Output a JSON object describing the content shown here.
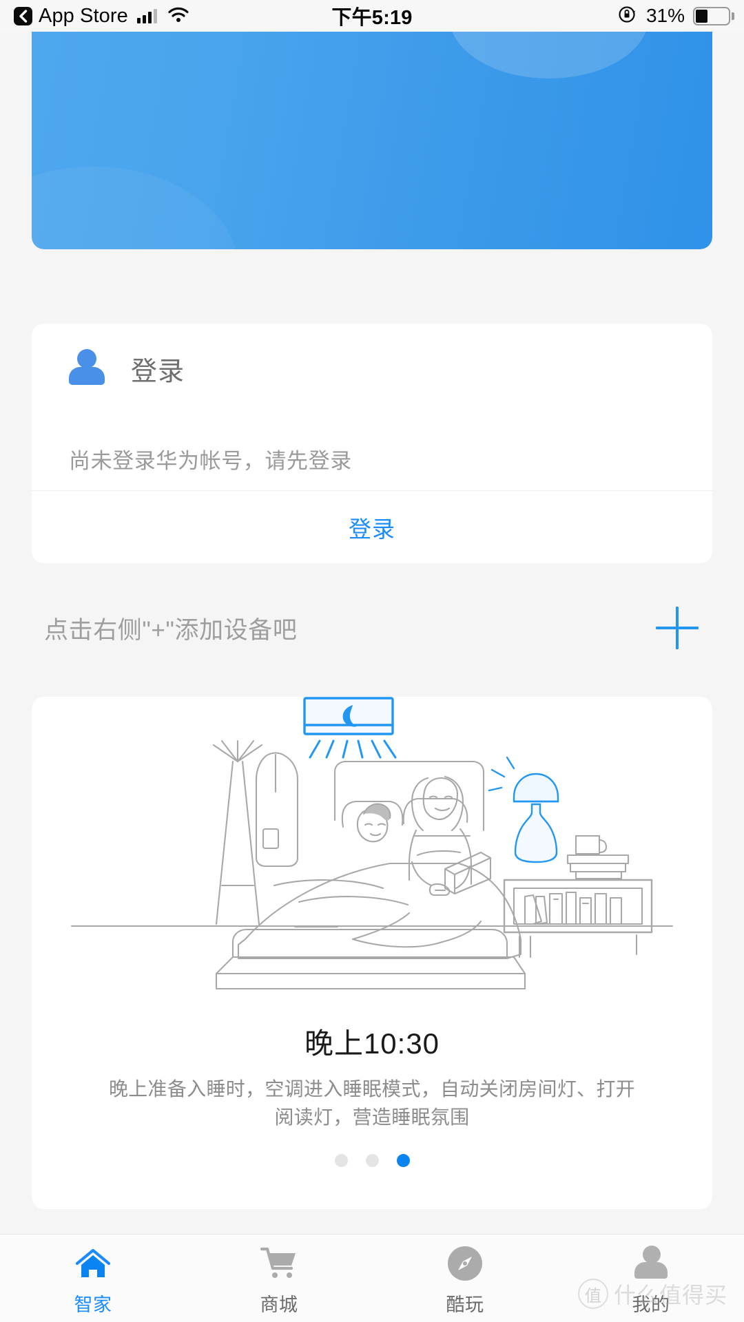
{
  "status_bar": {
    "back_app_label": "App Store",
    "time": "下午5:19",
    "battery_percent": "31%",
    "battery_level": 31,
    "icons": {
      "back": "back-chevron-icon",
      "signal": "cellular-signal-icon",
      "wifi": "wifi-icon",
      "rotation_lock": "rotation-lock-icon",
      "battery": "battery-icon"
    }
  },
  "banner": {
    "name": "header-banner",
    "gradient_from": "#4fa8ee",
    "gradient_to": "#2f92e8"
  },
  "login_card": {
    "title": "登录",
    "subtitle": "尚未登录华为帐号，请先登录",
    "button_label": "登录",
    "button_color": "#1a8cff",
    "avatar_color": "#4a90e8"
  },
  "add_device": {
    "hint": "点击右侧\"+\"添加设备吧",
    "plus_color": "#2196f3"
  },
  "scene_card": {
    "title": "晚上10:30",
    "description": "晚上准备入睡时，空调进入睡眠模式，自动关闭房间灯、打开阅读灯，营造睡眠氛围",
    "illustration": "bedroom-sleep-scene-illustration",
    "pagination": {
      "total": 3,
      "active_index": 2
    }
  },
  "tab_bar": {
    "active_index": 0,
    "active_color": "#1a8cff",
    "inactive_color": "#6b6b6b",
    "items": [
      {
        "label": "智家",
        "icon": "home-icon"
      },
      {
        "label": "商城",
        "icon": "shopping-cart-icon"
      },
      {
        "label": "酷玩",
        "icon": "compass-icon"
      },
      {
        "label": "我的",
        "icon": "person-icon"
      }
    ]
  },
  "watermark": {
    "text": "什么值得买",
    "logo_glyph": "值"
  }
}
